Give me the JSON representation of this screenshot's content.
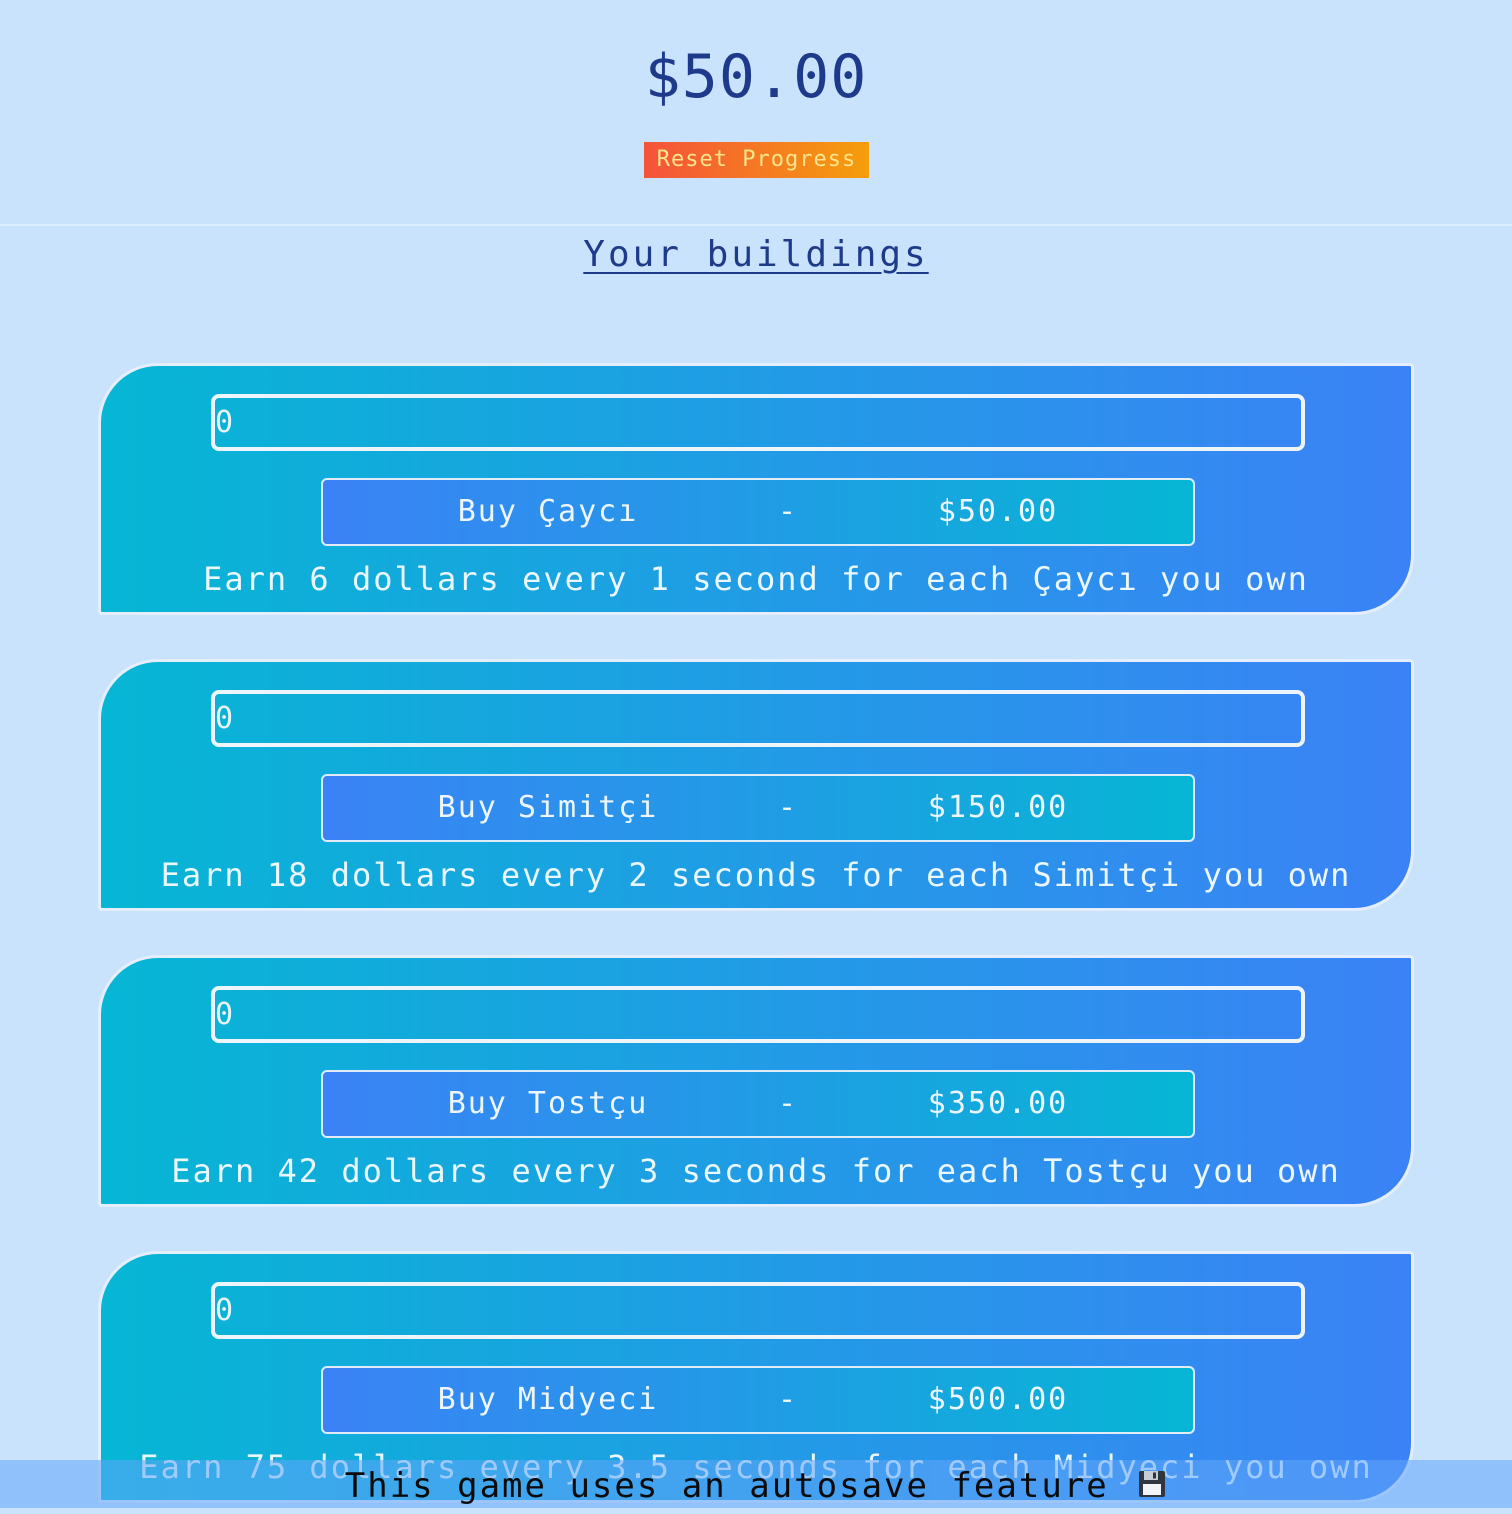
{
  "header": {
    "money": "$50.00",
    "reset_label": "Reset Progress"
  },
  "section_title": "Your buildings",
  "buildings": [
    {
      "owned": "0",
      "buy_label": "Buy Çaycı",
      "separator": "-",
      "price": "$50.00",
      "description": "Earn 6 dollars every 1 second for each Çaycı you own"
    },
    {
      "owned": "0",
      "buy_label": "Buy Simitçi",
      "separator": "-",
      "price": "$150.00",
      "description": "Earn 18 dollars every 2 seconds for each Simitçi you own"
    },
    {
      "owned": "0",
      "buy_label": "Buy Tostçu",
      "separator": "-",
      "price": "$350.00",
      "description": "Earn 42 dollars every 3 seconds for each Tostçu you own"
    },
    {
      "owned": "0",
      "buy_label": "Buy Midyeci",
      "separator": "-",
      "price": "$500.00",
      "description": "Earn 75 dollars every 3.5 seconds for each Midyeci you own"
    }
  ],
  "footer": {
    "text": "This game uses an autosave feature",
    "icon": "floppy-disk-icon"
  },
  "colors": {
    "background": "#cae3fd",
    "text_primary": "#1e3a8a",
    "card_gradient_start": "#06b6d4",
    "card_gradient_end": "#3b82f6",
    "reset_gradient_start": "#f5523b",
    "reset_gradient_end": "#f59e0b"
  }
}
